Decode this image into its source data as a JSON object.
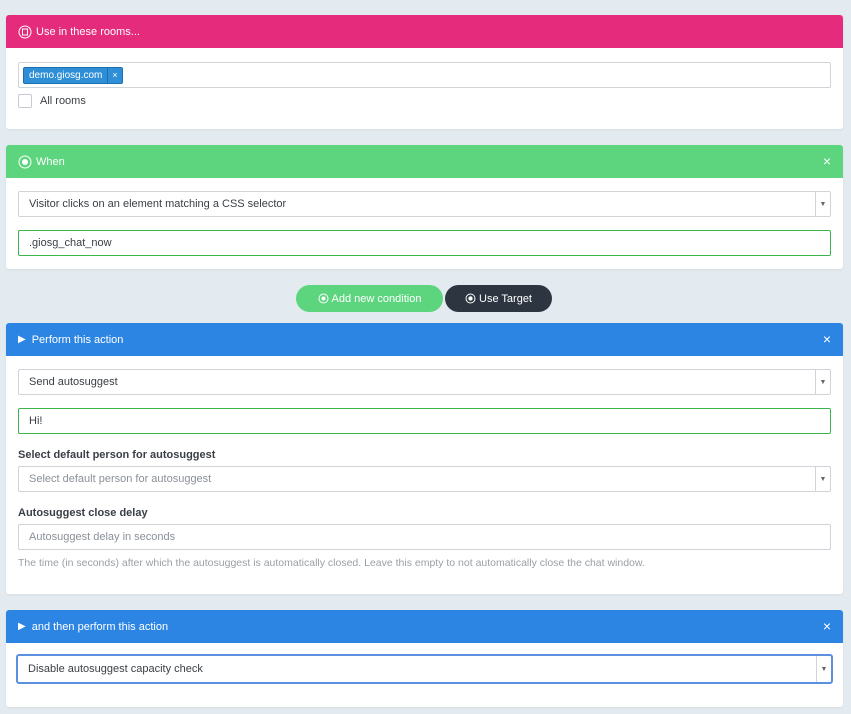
{
  "rooms": {
    "header": "Use in these rooms...",
    "tag": "demo.giosg.com",
    "tag_remove": "×",
    "all_rooms_label": "All rooms"
  },
  "when": {
    "header": "When",
    "close": "×",
    "trigger_select": "Visitor clicks on an element matching a CSS selector",
    "selector_value": ".giosg_chat_now"
  },
  "buttons": {
    "add_condition": "Add new condition",
    "use_target": "Use Target"
  },
  "action": {
    "header": "Perform this action",
    "close": "×",
    "action_select": "Send autosuggest",
    "message_value": "Hi!",
    "person_label": "Select default person for autosuggest",
    "person_placeholder": "Select default person for autosuggest",
    "delay_label": "Autosuggest close delay",
    "delay_placeholder": "Autosuggest delay in seconds",
    "delay_help": "The time (in seconds) after which the autosuggest is automatically closed. Leave this empty to not automatically close the chat window."
  },
  "then_action": {
    "header": "and then perform this action",
    "close": "×",
    "action_select": "Disable autosuggest capacity check"
  },
  "colors": {
    "pink": "#e42b7c",
    "green": "#5dd57f",
    "blue": "#2c85e3",
    "dark": "#2d3540"
  }
}
